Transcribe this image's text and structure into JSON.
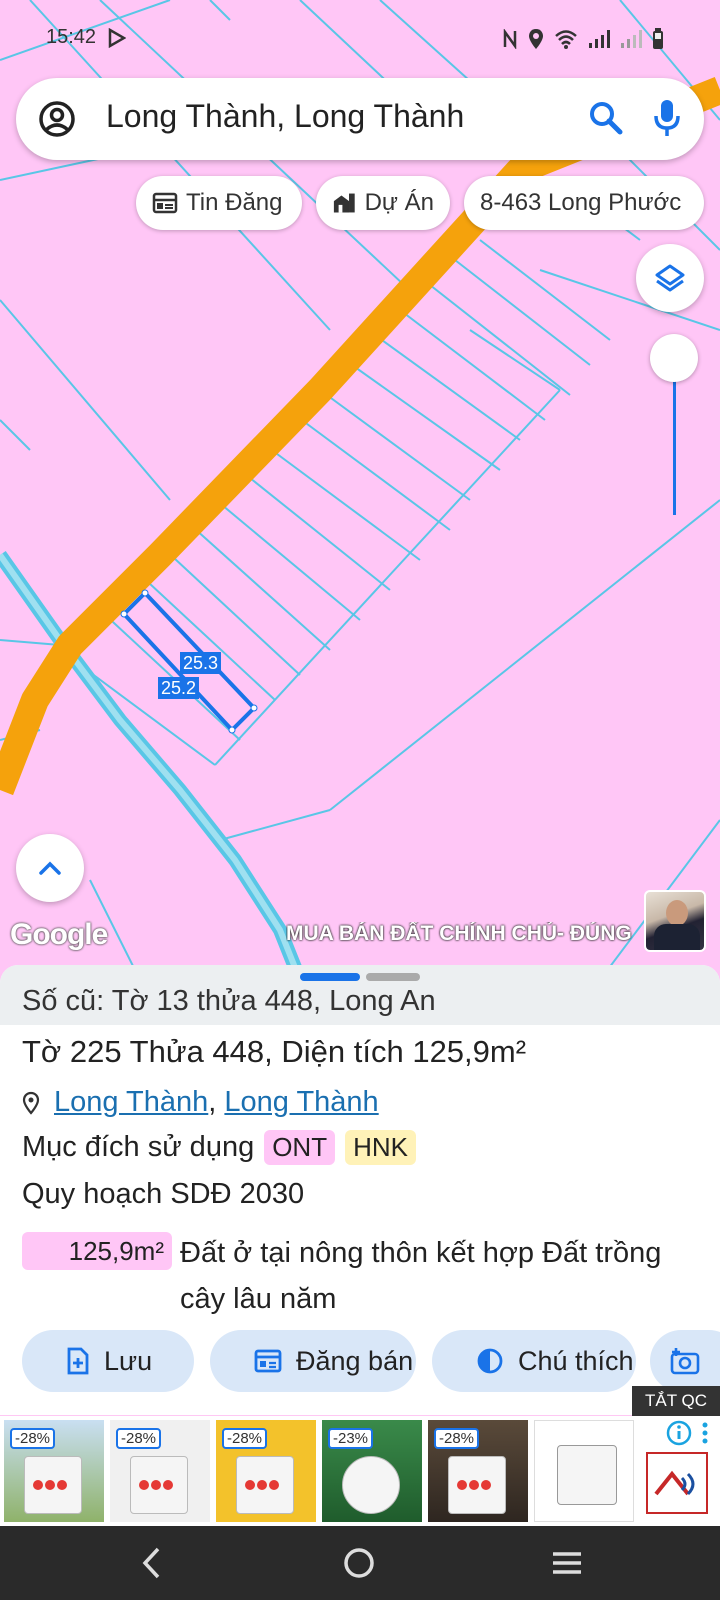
{
  "status_bar": {
    "time": "15:42"
  },
  "search": {
    "query": "Long Thành, Long Thành"
  },
  "chips": [
    {
      "label": "Tin Đăng",
      "icon": "listing-icon"
    },
    {
      "label": "Dự Án",
      "icon": "building-icon"
    },
    {
      "label": "8-463 Long Phước",
      "icon": ""
    }
  ],
  "map": {
    "parcel_labels": [
      "25.3",
      "25.2"
    ],
    "attribution": "Google",
    "ticker": "MUA BÁN ĐẤT CHÍNH CHỦ- ĐÚNG",
    "colors": {
      "land": "#ffc6f6",
      "road": "#f5a20c",
      "lines": "#59c6e6",
      "parcel": "#1a73e8"
    }
  },
  "sheet": {
    "old_record": "Số cũ: Tờ 13 thửa 448, Long An",
    "title": "Tờ 225 Thửa 448, Diện tích 125,9m²",
    "location_links": [
      "Long Thành",
      "Long Thành"
    ],
    "location_sep": ", ",
    "usage_label": "Mục đích sử dụng",
    "usage_tags": [
      "ONT",
      "HNK"
    ],
    "plan_label": "Quy hoạch SDĐ 2030",
    "area_value": "125,9m²",
    "area_desc": "Đất ở tại nông thôn kết hợp Đất trồng cây lâu năm"
  },
  "actions": [
    {
      "label": "Lưu",
      "icon": "save-add-icon"
    },
    {
      "label": "Đăng bán",
      "icon": "post-sale-icon"
    },
    {
      "label": "Chú thích",
      "icon": "legend-icon"
    },
    {
      "label": "",
      "icon": "camera-add-icon"
    }
  ],
  "ads": {
    "close_label": "TẮT QC",
    "discounts": [
      "-28%",
      "-28%",
      "-28%",
      "-23%",
      "-28%"
    ],
    "info_icon": "info-icon"
  }
}
